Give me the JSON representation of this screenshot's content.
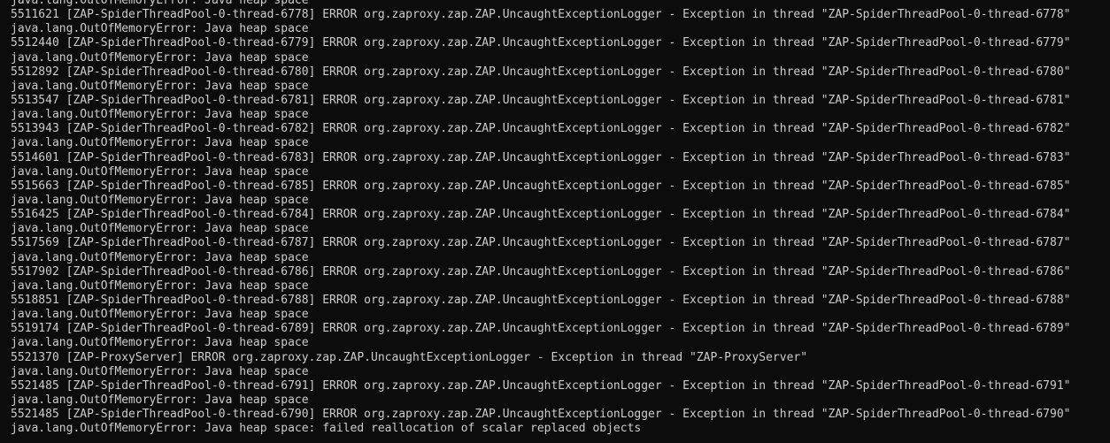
{
  "terminal": {
    "lines": [
      "java.lang.OutOfMemoryError: Java heap space",
      "5511621 [ZAP-SpiderThreadPool-0-thread-6778] ERROR org.zaproxy.zap.ZAP.UncaughtExceptionLogger - Exception in thread \"ZAP-SpiderThreadPool-0-thread-6778\"",
      "java.lang.OutOfMemoryError: Java heap space",
      "5512440 [ZAP-SpiderThreadPool-0-thread-6779] ERROR org.zaproxy.zap.ZAP.UncaughtExceptionLogger - Exception in thread \"ZAP-SpiderThreadPool-0-thread-6779\"",
      "java.lang.OutOfMemoryError: Java heap space",
      "5512892 [ZAP-SpiderThreadPool-0-thread-6780] ERROR org.zaproxy.zap.ZAP.UncaughtExceptionLogger - Exception in thread \"ZAP-SpiderThreadPool-0-thread-6780\"",
      "java.lang.OutOfMemoryError: Java heap space",
      "5513547 [ZAP-SpiderThreadPool-0-thread-6781] ERROR org.zaproxy.zap.ZAP.UncaughtExceptionLogger - Exception in thread \"ZAP-SpiderThreadPool-0-thread-6781\"",
      "java.lang.OutOfMemoryError: Java heap space",
      "5513943 [ZAP-SpiderThreadPool-0-thread-6782] ERROR org.zaproxy.zap.ZAP.UncaughtExceptionLogger - Exception in thread \"ZAP-SpiderThreadPool-0-thread-6782\"",
      "java.lang.OutOfMemoryError: Java heap space",
      "5514601 [ZAP-SpiderThreadPool-0-thread-6783] ERROR org.zaproxy.zap.ZAP.UncaughtExceptionLogger - Exception in thread \"ZAP-SpiderThreadPool-0-thread-6783\"",
      "java.lang.OutOfMemoryError: Java heap space",
      "5515663 [ZAP-SpiderThreadPool-0-thread-6785] ERROR org.zaproxy.zap.ZAP.UncaughtExceptionLogger - Exception in thread \"ZAP-SpiderThreadPool-0-thread-6785\"",
      "java.lang.OutOfMemoryError: Java heap space",
      "5516425 [ZAP-SpiderThreadPool-0-thread-6784] ERROR org.zaproxy.zap.ZAP.UncaughtExceptionLogger - Exception in thread \"ZAP-SpiderThreadPool-0-thread-6784\"",
      "java.lang.OutOfMemoryError: Java heap space",
      "5517569 [ZAP-SpiderThreadPool-0-thread-6787] ERROR org.zaproxy.zap.ZAP.UncaughtExceptionLogger - Exception in thread \"ZAP-SpiderThreadPool-0-thread-6787\"",
      "java.lang.OutOfMemoryError: Java heap space",
      "5517902 [ZAP-SpiderThreadPool-0-thread-6786] ERROR org.zaproxy.zap.ZAP.UncaughtExceptionLogger - Exception in thread \"ZAP-SpiderThreadPool-0-thread-6786\"",
      "java.lang.OutOfMemoryError: Java heap space",
      "5518851 [ZAP-SpiderThreadPool-0-thread-6788] ERROR org.zaproxy.zap.ZAP.UncaughtExceptionLogger - Exception in thread \"ZAP-SpiderThreadPool-0-thread-6788\"",
      "java.lang.OutOfMemoryError: Java heap space",
      "5519174 [ZAP-SpiderThreadPool-0-thread-6789] ERROR org.zaproxy.zap.ZAP.UncaughtExceptionLogger - Exception in thread \"ZAP-SpiderThreadPool-0-thread-6789\"",
      "java.lang.OutOfMemoryError: Java heap space",
      "5521370 [ZAP-ProxyServer] ERROR org.zaproxy.zap.ZAP.UncaughtExceptionLogger - Exception in thread \"ZAP-ProxyServer\"",
      "java.lang.OutOfMemoryError: Java heap space",
      "5521485 [ZAP-SpiderThreadPool-0-thread-6791] ERROR org.zaproxy.zap.ZAP.UncaughtExceptionLogger - Exception in thread \"ZAP-SpiderThreadPool-0-thread-6791\"",
      "java.lang.OutOfMemoryError: Java heap space",
      "5521485 [ZAP-SpiderThreadPool-0-thread-6790] ERROR org.zaproxy.zap.ZAP.UncaughtExceptionLogger - Exception in thread \"ZAP-SpiderThreadPool-0-thread-6790\"",
      "java.lang.OutOfMemoryError: Java heap space: failed reallocation of scalar replaced objects"
    ],
    "colors": {
      "background": "#0c0c0c",
      "text": "#cccccc"
    }
  }
}
